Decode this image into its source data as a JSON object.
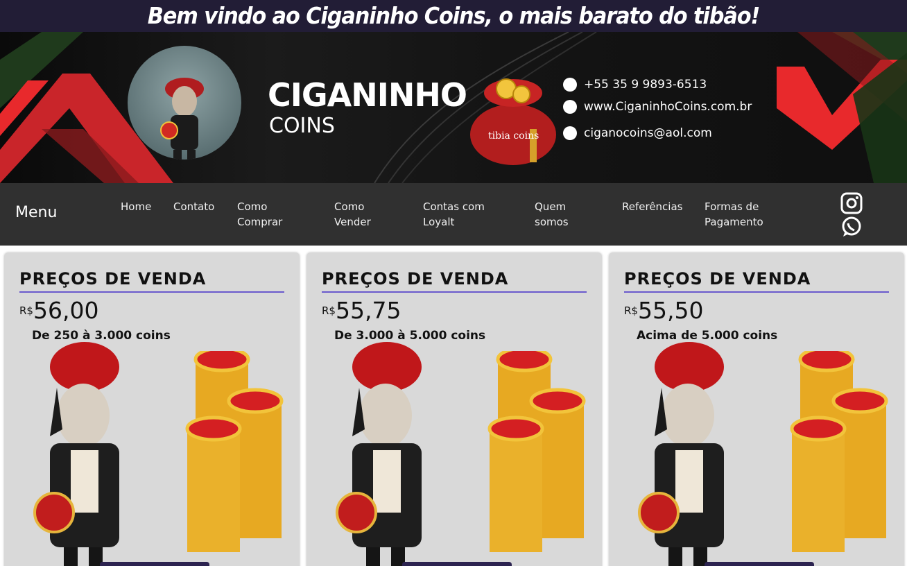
{
  "top_banner": {
    "text": "Bem vindo ao Ciganinho Coins, o mais barato do tibão!"
  },
  "brand": {
    "name": "CIGANINHO",
    "sub": "COINS",
    "bag_text": "tibia coins",
    "accent": "#e8292c"
  },
  "contacts": [
    {
      "icon": "phone-icon",
      "text": "+55 35 9 9893-6513"
    },
    {
      "icon": "globe-icon",
      "text": "www.CiganinhoCoins.com.br"
    },
    {
      "icon": "email-icon",
      "text": "ciganocoins@aol.com"
    }
  ],
  "nav": {
    "menu_label": "Menu",
    "items": [
      {
        "label": "Home"
      },
      {
        "label": "Contato"
      },
      {
        "label": "Como\nComprar"
      },
      {
        "label": "Como\nVender"
      },
      {
        "label": "Contas com\nLoyalt"
      },
      {
        "label": "Quem\nsomos"
      },
      {
        "label": "Referências"
      },
      {
        "label": "Formas de\nPagamento"
      }
    ],
    "social": [
      "instagram-icon",
      "whatsapp-icon"
    ]
  },
  "cards": [
    {
      "heading": "PREÇOS DE VENDA",
      "currency": "R$",
      "price": "56,00",
      "desc": "De 250 à 3.000 coins"
    },
    {
      "heading": "PREÇOS DE VENDA",
      "currency": "R$",
      "price": "55,75",
      "desc": "De 3.000 à 5.000 coins"
    },
    {
      "heading": "PREÇOS DE VENDA",
      "currency": "R$",
      "price": "55,50",
      "desc": "Acima de 5.000 coins"
    }
  ]
}
